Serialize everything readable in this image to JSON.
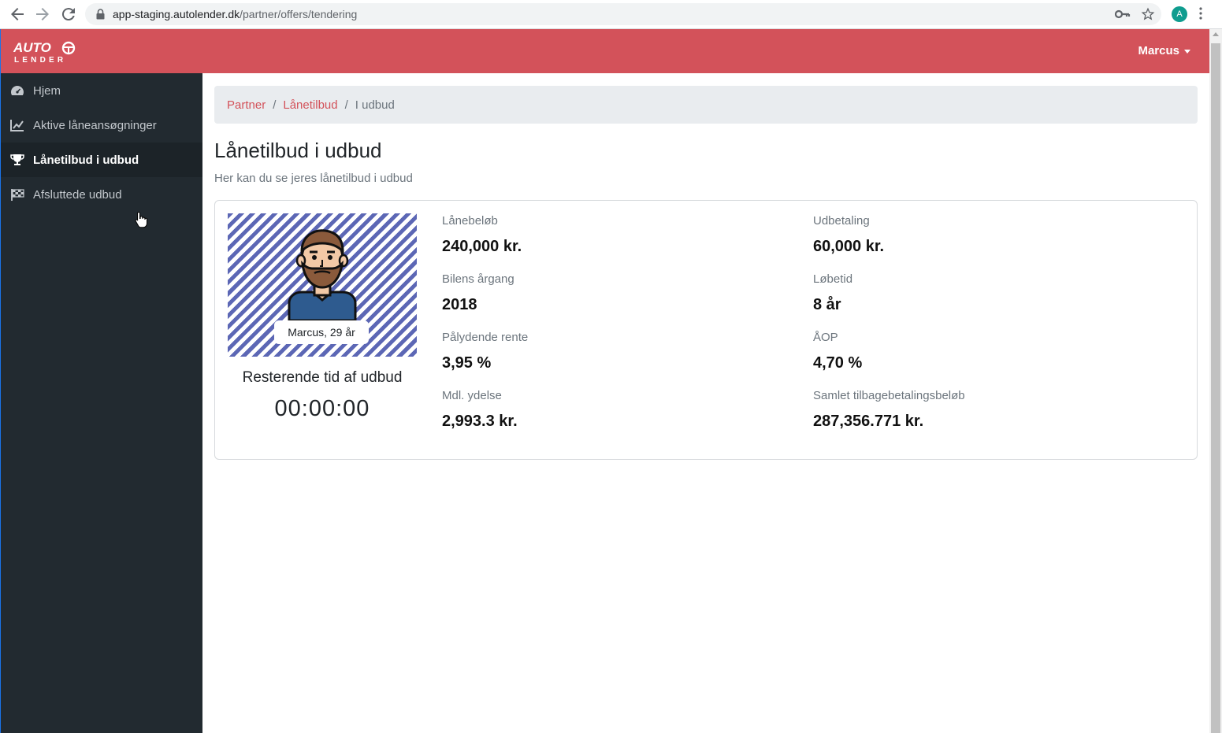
{
  "browser": {
    "url_host": "app-staging.autolender.dk",
    "url_path": "/partner/offers/tendering",
    "profile_initial": "A"
  },
  "brand": {
    "line1": "AUTO",
    "line2": "LENDER"
  },
  "topbar": {
    "user_name": "Marcus"
  },
  "sidebar": {
    "items": [
      {
        "label": "Hjem",
        "icon": "dashboard-icon",
        "active": false
      },
      {
        "label": "Aktive låneansøgninger",
        "icon": "chart-edit-icon",
        "active": false
      },
      {
        "label": "Lånetilbud i udbud",
        "icon": "trophy-icon",
        "active": true
      },
      {
        "label": "Afsluttede udbud",
        "icon": "flag-checkered-icon",
        "active": false
      }
    ]
  },
  "breadcrumb": {
    "items": [
      "Partner",
      "Lånetilbud"
    ],
    "current": "I udbud"
  },
  "page": {
    "title": "Lånetilbud i udbud",
    "subtitle": "Her kan du se jeres lånetilbud i udbud"
  },
  "offer": {
    "customer": "Marcus, 29 år",
    "remaining_label": "Resterende tid af udbud",
    "countdown": "00:00:00",
    "fields": [
      {
        "label": "Lånebeløb",
        "value": "240,000 kr."
      },
      {
        "label": "Udbetaling",
        "value": "60,000 kr."
      },
      {
        "label": "Bilens årgang",
        "value": "2018"
      },
      {
        "label": "Løbetid",
        "value": "8 år"
      },
      {
        "label": "Pålydende rente",
        "value": "3,95 %"
      },
      {
        "label": "ÅOP",
        "value": "4,70 %"
      },
      {
        "label": "Mdl. ydelse",
        "value": "2,993.3 kr."
      },
      {
        "label": "Samlet tilbagebetalingsbeløb",
        "value": "287,356.771 kr."
      }
    ]
  },
  "colors": {
    "brand_red": "#d3525a",
    "sidebar_bg": "#222a30",
    "stripe_blue": "#5c67b5"
  }
}
